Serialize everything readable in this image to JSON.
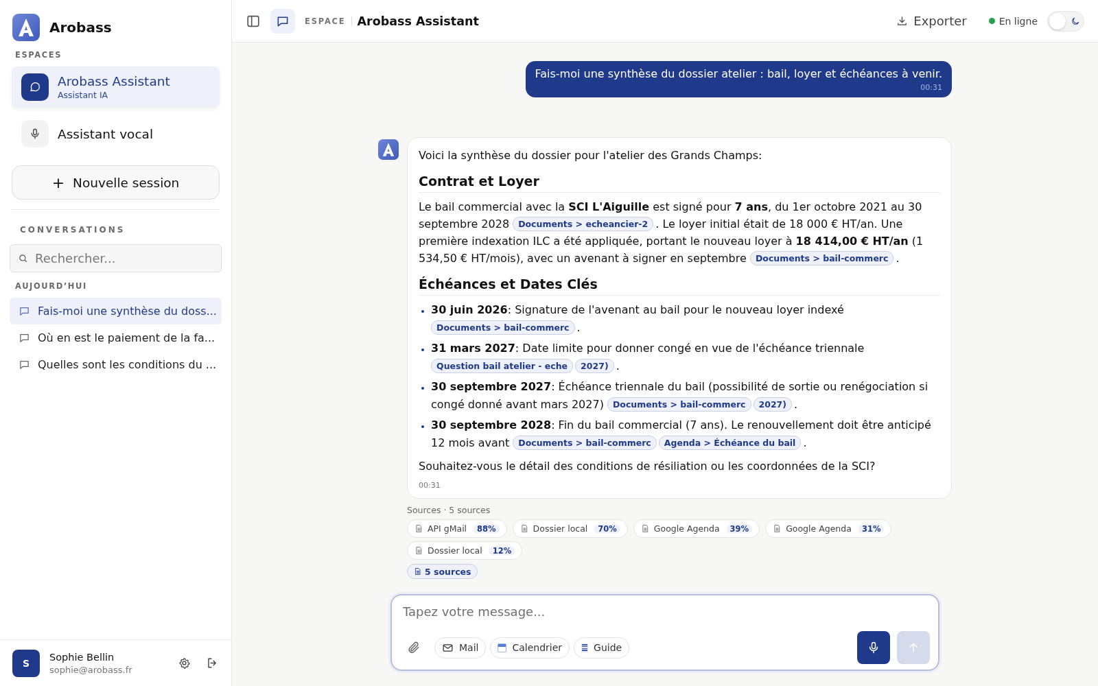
{
  "sidebar": {
    "brand": "Arobass",
    "spaces_label": "ESPACES",
    "spaces": [
      {
        "kind": "chat",
        "title": "Arobass Assistant",
        "subtitle": "Assistant IA",
        "selected": true
      },
      {
        "kind": "mic",
        "title": "Assistant vocal",
        "selected": false
      }
    ],
    "new_session": {
      "icon": "+",
      "label": "Nouvelle session"
    },
    "conversations_label": "CONVERSATIONS",
    "search": {
      "placeholder": "Rechercher..."
    },
    "group_label": "AUJOURD’HUI",
    "conversations": [
      {
        "title": "Fais-moi une synthèse du doss...",
        "selected": true
      },
      {
        "title": "Où en est le paiement de la fa...",
        "selected": false
      },
      {
        "title": "Quelles sont les conditions du ...",
        "selected": false
      }
    ],
    "user": {
      "initial": "S",
      "name": "Sophie Bellin",
      "email": "sophie@arobass.fr"
    }
  },
  "header": {
    "space_label": "ESPACE",
    "title": "Arobass Assistant",
    "export": "Exporter",
    "status": "En ligne",
    "online": true,
    "dark_mode": false
  },
  "messages": [
    {
      "kind": "user",
      "text": "Fais-moi une synthèse du dossier atelier : bail, loyer et échéances à venir.",
      "time": "00:31"
    },
    {
      "kind": "assistant",
      "time": "00:31",
      "blocks": [
        {
          "kind": "paragraph",
          "parts": [
            {
              "kind": "text",
              "text": "Voici la synthèse du dossier pour l'atelier des Grands Champs:"
            }
          ]
        },
        {
          "kind": "heading",
          "text": "Contrat et Loyer"
        },
        {
          "kind": "paragraph",
          "parts": [
            {
              "kind": "text",
              "text": "Le bail commercial avec la **SCI L'Aiguille** est signé pour **7 ans**, du 1er octobre 2021 au 30 septembre 2028 "
            },
            {
              "kind": "chip",
              "text": "Documents > echeancier-2"
            },
            {
              "kind": "text",
              "text": ". Le loyer initial était de 18 000 € HT/an. Une première indexation ILC a été appliquée, portant le nouveau loyer à **18 414,00 € HT/an** (1 534,50 € HT/mois), avec un avenant à signer en septembre "
            },
            {
              "kind": "chip",
              "text": "Documents > bail-commerc"
            },
            {
              "kind": "text",
              "text": "."
            }
          ]
        },
        {
          "kind": "heading",
          "text": "Échéances et Dates Clés"
        },
        {
          "kind": "list",
          "items": [
            {
              "parts": [
                {
                  "kind": "text",
                  "text": "**30 juin 2026**: Signature de l'avenant au bail pour le nouveau loyer indexé "
                },
                {
                  "kind": "chip",
                  "text": "Documents > bail-commerc"
                },
                {
                  "kind": "text",
                  "text": "."
                }
              ]
            },
            {
              "parts": [
                {
                  "kind": "text",
                  "text": "**31 mars 2027**: Date limite pour donner congé en vue de l'échéance triennale "
                },
                {
                  "kind": "chip",
                  "text": "Question bail atelier - eche"
                },
                {
                  "kind": "chip",
                  "text": "2027)"
                },
                {
                  "kind": "text",
                  "text": "."
                }
              ]
            },
            {
              "parts": [
                {
                  "kind": "text",
                  "text": "**30 septembre 2027**: Échéance triennale du bail (possibilité de sortie ou renégociation si congé donné avant mars 2027) "
                },
                {
                  "kind": "chip",
                  "text": "Documents > bail-commerc"
                },
                {
                  "kind": "chip",
                  "text": "2027)"
                },
                {
                  "kind": "text",
                  "text": "."
                }
              ]
            },
            {
              "parts": [
                {
                  "kind": "text",
                  "text": "**30 septembre 2028**: Fin du bail commercial (7 ans). Le renouvellement doit être anticipé 12 mois avant "
                },
                {
                  "kind": "chip",
                  "text": "Documents > bail-commerc"
                },
                {
                  "kind": "chip",
                  "text": "Agenda > Échéance du bail"
                },
                {
                  "kind": "text",
                  "text": "."
                }
              ]
            }
          ]
        },
        {
          "kind": "paragraph",
          "parts": [
            {
              "kind": "text",
              "text": "Souhaitez-vous le détail des conditions de résiliation ou les coordonnées de la SCI?"
            }
          ]
        }
      ],
      "sources_label": "Sources · 5 sources",
      "sources": [
        {
          "name": "API gMail",
          "score": "88%"
        },
        {
          "name": "Dossier local",
          "score": "70%"
        },
        {
          "name": "Google Agenda",
          "score": "39%"
        },
        {
          "name": "Google Agenda",
          "score": "31%"
        },
        {
          "name": "Dossier local",
          "score": "12%"
        }
      ],
      "sources_button": "5 sources"
    }
  ],
  "composer": {
    "placeholder": "Tapez votre message...",
    "tools": [
      {
        "kind": "mail",
        "label": "Mail"
      },
      {
        "kind": "calendar",
        "label": "Calendrier"
      },
      {
        "kind": "guide",
        "label": "Guide"
      }
    ],
    "send_disabled": true
  }
}
